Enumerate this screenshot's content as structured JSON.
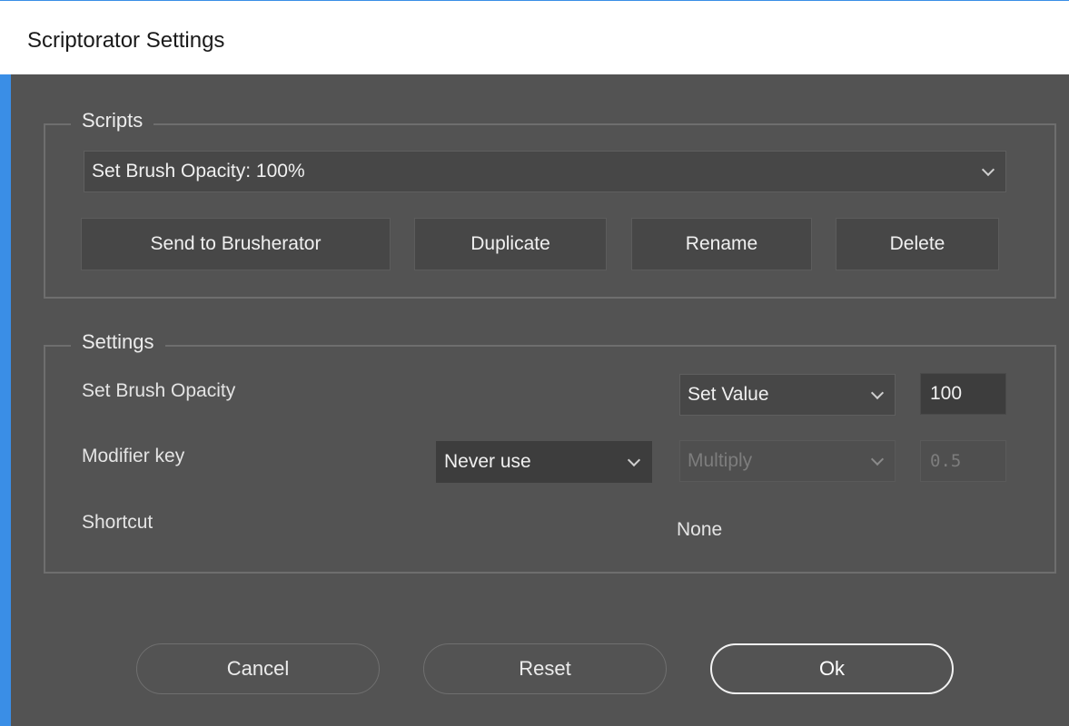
{
  "window": {
    "title": "Scriptorator Settings"
  },
  "scripts": {
    "legend": "Scripts",
    "selected_script": "Set Brush Opacity: 100%",
    "buttons": {
      "send": "Send to Brusherator",
      "duplicate": "Duplicate",
      "rename": "Rename",
      "delete": "Delete"
    }
  },
  "settings": {
    "legend": "Settings",
    "brush_opacity": {
      "label": "Set Brush Opacity",
      "mode": "Set Value",
      "value": "100"
    },
    "modifier": {
      "label": "Modifier key",
      "use": "Never use",
      "operation": "Multiply",
      "factor": "0.5"
    },
    "shortcut": {
      "label": "Shortcut",
      "value": "None"
    }
  },
  "footer": {
    "cancel": "Cancel",
    "reset": "Reset",
    "ok": "Ok"
  },
  "colors": {
    "background": "#535353",
    "titlebar": "#ffffff",
    "accent": "#3a8ee6"
  },
  "icons": {
    "dropdown": "chevron-down-icon"
  }
}
